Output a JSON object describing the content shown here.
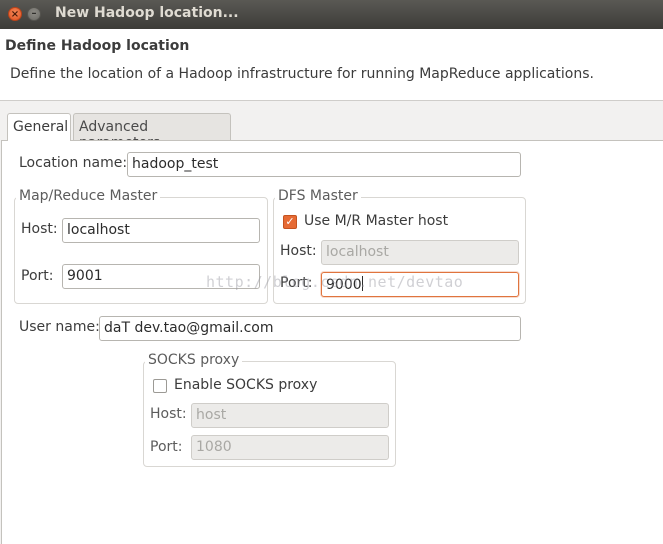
{
  "window": {
    "title": "New Hadoop location...",
    "close_glyph": "×",
    "minimize_glyph": "–"
  },
  "header": {
    "title": "Define Hadoop location",
    "description": "Define the location of a Hadoop infrastructure for running MapReduce applications."
  },
  "tabs": [
    {
      "label": "General",
      "active": true
    },
    {
      "label": "Advanced parameters",
      "active": false
    }
  ],
  "form": {
    "location_name_label": "Location name:",
    "location_name_value": "hadoop_test",
    "mr_master": {
      "title": "Map/Reduce Master",
      "host_label": "Host:",
      "host_value": "localhost",
      "port_label": "Port:",
      "port_value": "9001"
    },
    "dfs_master": {
      "title": "DFS Master",
      "use_mr_host_label": "Use M/R Master host",
      "use_mr_host_checked": true,
      "check_glyph": "✓",
      "host_label": "Host:",
      "host_value": "localhost",
      "port_label": "Port:",
      "port_value": "9000"
    },
    "user_name_label": "User name:",
    "user_name_value": "daT dev.tao@gmail.com",
    "socks": {
      "title": "SOCKS proxy",
      "enable_label": "Enable SOCKS proxy",
      "enabled": false,
      "host_label": "Host:",
      "host_value": "host",
      "port_label": "Port:",
      "port_value": "1080"
    }
  },
  "watermark": "http://blog.csdn.net/devtao"
}
